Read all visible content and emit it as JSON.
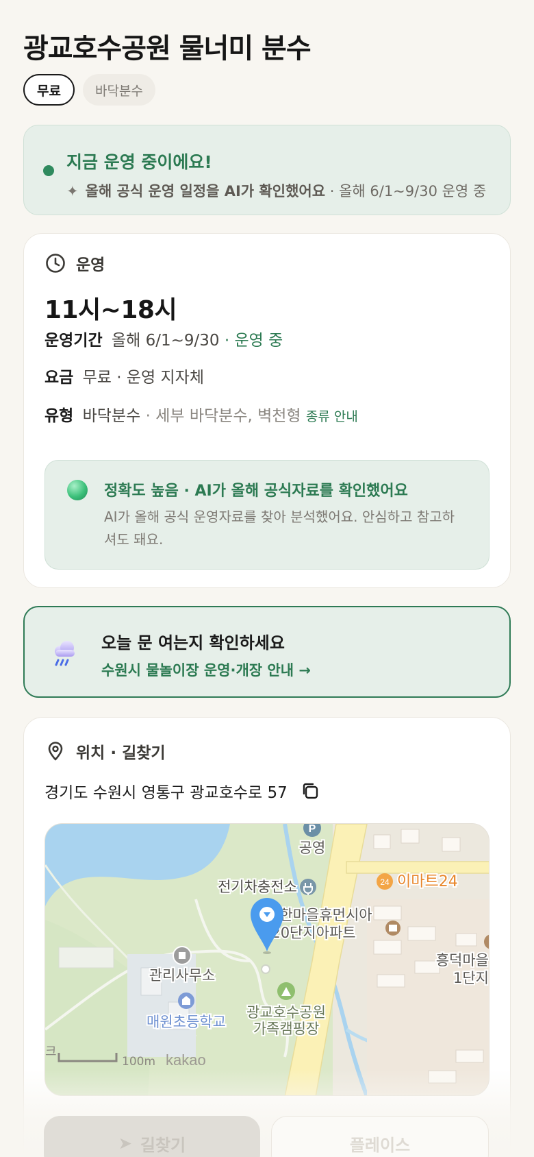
{
  "header": {
    "title": "광교호수공원 물너미 분수",
    "chips": [
      "무료",
      "바닥분수"
    ]
  },
  "status": {
    "title": "지금 운영 중이에요!",
    "sub_bold": "올해 공식 운영 일정을 AI가 확인했어요",
    "sub_rest": "· 올해 6/1~9/30 운영 중",
    "dot_color": "#2f8a5e"
  },
  "operation": {
    "section_label": "운영",
    "section_icon": "clock-icon",
    "hours": "11시~18시",
    "period_key": "운영기간",
    "period_value": "올해 6/1~9/30",
    "period_status": "· 운영 중",
    "fee_key": "요금",
    "fee_value": "무료 · 운영 지자체",
    "type_key": "유형",
    "type_value": "바닥분수",
    "type_detail": "· 세부 바닥분수, 벽천형",
    "type_link": "종류 안내",
    "accuracy": {
      "title": "정확도 높음 · AI가 올해 공식자료를 확인했어요",
      "body": "AI가 올해 공식 운영자료를 찾아 분석했어요. 안심하고 참고하셔도 돼요."
    }
  },
  "notice": {
    "icon": "rain-cloud-icon",
    "title": "오늘 문 여는지 확인하세요",
    "link": "수원시 물놀이장 운영·개장 안내 →"
  },
  "location": {
    "section_label": "위치 · 길찾기",
    "section_icon": "pin-icon",
    "address": "경기도 수원시 영통구 광교호수로 57",
    "map": {
      "labels": {
        "parking": "공영",
        "ev": "전기차충전소",
        "emart": "이마트24",
        "apt": "한마을휴먼시아",
        "apt2": "20단지아파트",
        "office": "관리사무소",
        "school": "매원초등학교",
        "camp": "광교호수공원",
        "camp2": "가족캠핑장",
        "heung": "흥덕마을",
        "heung2": "1단지",
        "scale": "100m",
        "brand": "kakao",
        "edge": "크"
      }
    }
  },
  "buttons": {
    "directions": "길찾기",
    "place": "플레이스"
  }
}
